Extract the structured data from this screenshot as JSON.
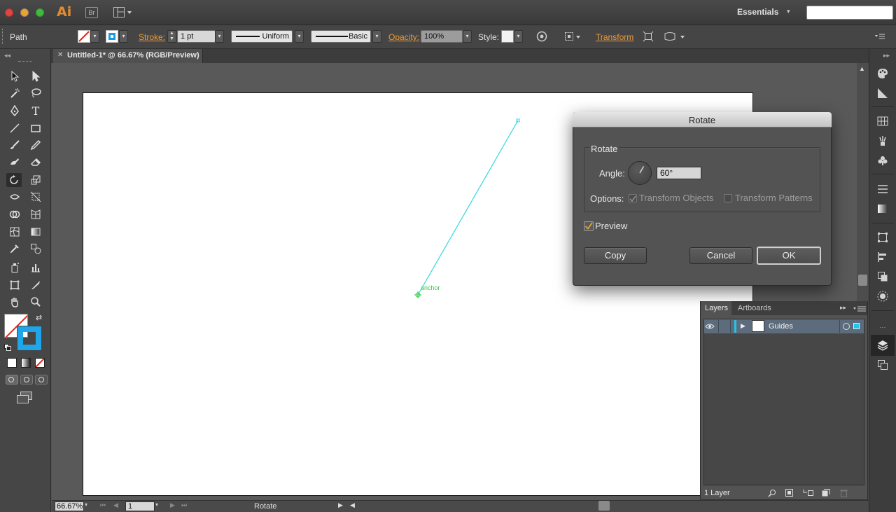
{
  "app": {
    "logo": "Ai",
    "bridge_label": "Br",
    "workspace": "Essentials"
  },
  "control_bar": {
    "selection_type": "Path",
    "stroke_label": "Stroke:",
    "stroke_weight": "1 pt",
    "stroke_profile": "Uniform",
    "brush": "Basic",
    "opacity_label": "Opacity:",
    "opacity_value": "100%",
    "style_label": "Style:",
    "transform_label": "Transform"
  },
  "document": {
    "tab_title": "Untitled-1* @ 66.67% (RGB/Preview)",
    "anchor_label": "anchor"
  },
  "status_bar": {
    "zoom": "66.67%",
    "artboard_number": "1",
    "current_tool": "Rotate"
  },
  "dialog": {
    "title": "Rotate",
    "group_label": "Rotate",
    "angle_label": "Angle:",
    "angle_value": "60°",
    "options_label": "Options:",
    "transform_objects": "Transform Objects",
    "transform_patterns": "Transform Patterns",
    "preview_label": "Preview",
    "copy_button": "Copy",
    "cancel_button": "Cancel",
    "ok_button": "OK"
  },
  "layers_panel": {
    "tabs": [
      "Layers",
      "Artboards"
    ],
    "layers": [
      {
        "name": "Guides"
      }
    ],
    "layer_count": "1 Layer"
  },
  "colors": {
    "accent": "#ec9a3a",
    "guide_line": "#33d6e0",
    "anchor": "#2ecc40",
    "layer_color": "#26c4e8"
  }
}
